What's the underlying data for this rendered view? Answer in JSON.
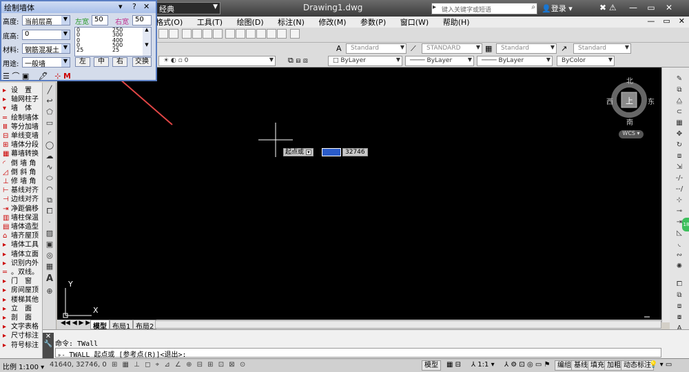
{
  "titlebar": {
    "workspace": "经典",
    "document": "Drawing1.dwg",
    "search_placeholder": "键入关键字或短语",
    "login": "登录",
    "window_controls": [
      "—",
      "▭",
      "✕"
    ]
  },
  "menubar": {
    "items": [
      "格式(O)",
      "工具(T)",
      "绘图(D)",
      "标注(N)",
      "修改(M)",
      "参数(P)",
      "窗口(W)",
      "帮助(H)"
    ],
    "controls": [
      "—",
      "▭",
      "✕"
    ]
  },
  "toolbar_styles": {
    "text_style": "Standard",
    "dim_style": "STANDARD",
    "table_style": "Standard",
    "mleader_style": "Standard"
  },
  "toolbar_layers": {
    "layer": "0",
    "color": "ByLayer",
    "linetype": "ByLayer",
    "lineweight": "ByLayer",
    "plotstyle": "ByColor"
  },
  "dialog": {
    "title": "绘制墙体",
    "height_label": "高度:",
    "height_value": "当前层高",
    "left_width_label": "左宽",
    "left_width_value": "50",
    "right_width_label": "右宽",
    "right_width_value": "50",
    "base_height_label": "底高:",
    "base_height_value": "0",
    "material_label": "材料:",
    "material_value": "钢筋混凝土",
    "usage_label": "用途:",
    "usage_value": "一般墙",
    "list_col1": [
      "0",
      "0",
      "0",
      "0",
      "25"
    ],
    "list_col2": [
      "250",
      "300",
      "400",
      "500",
      "25"
    ],
    "btn_left": "左",
    "btn_center": "中",
    "btn_right": "右",
    "btn_swap": "交换",
    "help": "?"
  },
  "palette": {
    "items": [
      {
        "g": "▸",
        "t": "设　置"
      },
      {
        "g": "▸",
        "t": "轴网柱子"
      },
      {
        "g": "▾",
        "t": "墙　体"
      },
      {
        "g": "═",
        "t": "绘制墙体"
      },
      {
        "g": "Ⅲ",
        "t": "等分加墙"
      },
      {
        "g": "⊟",
        "t": "单线变墙"
      },
      {
        "g": "⊞",
        "t": "墙体分段"
      },
      {
        "g": "▦",
        "t": "幕墙转换"
      },
      {
        "g": "◜",
        "t": "倒 墙 角"
      },
      {
        "g": "◿",
        "t": "倒 斜 角"
      },
      {
        "g": "⊥",
        "t": "修 墙 角"
      },
      {
        "g": "⊢",
        "t": "基线对齐"
      },
      {
        "g": "⊣",
        "t": "边线对齐"
      },
      {
        "g": "⇥",
        "t": "净距偏移"
      },
      {
        "g": "▥",
        "t": "墙柱保温"
      },
      {
        "g": "▤",
        "t": "墙体造型"
      },
      {
        "g": "⌂",
        "t": "墙齐屋顶"
      },
      {
        "g": "▸",
        "t": "墙体工具"
      },
      {
        "g": "▸",
        "t": "墙体立面"
      },
      {
        "g": "▸",
        "t": "识别内外"
      },
      {
        "g": "═",
        "t": "。双线。"
      },
      {
        "g": "▸",
        "t": "门　窗"
      },
      {
        "g": "▸",
        "t": "房间屋顶"
      },
      {
        "g": "▸",
        "t": "楼梯其他"
      },
      {
        "g": "▸",
        "t": "立　面"
      },
      {
        "g": "▸",
        "t": "剖　面"
      },
      {
        "g": "▸",
        "t": "文字表格"
      },
      {
        "g": "▸",
        "t": "尺寸标注"
      },
      {
        "g": "▸",
        "t": "符号标注"
      }
    ]
  },
  "viewcube": {
    "north": "北",
    "south": "南",
    "east": "东",
    "west": "西",
    "top": "上",
    "wcs": "WCS"
  },
  "canvas": {
    "prompt_label": "起点或",
    "coord_value": "32746",
    "ucs_x": "X",
    "ucs_y": "Y"
  },
  "tabs": [
    "模型",
    "布局1",
    "布局2"
  ],
  "command": {
    "history": "命令: TWall",
    "prompt": "TWALL 起点或 [参考点(R)]<退出>:"
  },
  "status": {
    "scale": "比例 1:100",
    "coords": "41640, 32746, 0",
    "model": "模型",
    "annotation_scale": "1:1",
    "buttons": [
      "编组",
      "基线",
      "填充",
      "加粗",
      "动态标注"
    ]
  },
  "colors": {
    "canvas_bg": "#000000",
    "dialog_border": "#5b7fc3",
    "left_width_color": "#2e9c2e",
    "right_width_color": "#c0308f",
    "arrow": "#e04545"
  }
}
